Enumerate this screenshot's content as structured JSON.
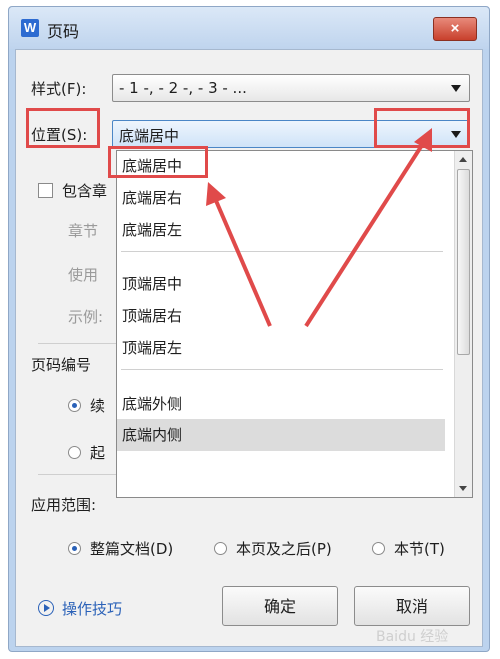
{
  "window": {
    "app_icon_letter": "W",
    "title": "页码",
    "close_label": "×"
  },
  "style_row": {
    "label": "样式(F):",
    "value": "- 1 -, - 2 -, - 3 - ..."
  },
  "position_row": {
    "label": "位置(S):",
    "value": "底端居中"
  },
  "include_chapter": {
    "label": "包含章",
    "checked": false
  },
  "chapter_start_label": "章节",
  "use_label": "使用",
  "example_label": "示例:",
  "numbering_section": "页码编号",
  "numbering_continue": "续",
  "numbering_start": "起",
  "dropdown": {
    "options": [
      "底端居中",
      "底端居右",
      "底端居左",
      "顶端居中",
      "顶端居右",
      "顶端居左",
      "底端外侧",
      "底端内侧"
    ],
    "highlighted": "底端内侧"
  },
  "apply_section": {
    "label": "应用范围:",
    "options": [
      "整篇文档(D)",
      "本页及之后(P)",
      "本节(T)"
    ],
    "selected": "整篇文档(D)"
  },
  "tips_link": "操作技巧",
  "ok_label": "确定",
  "cancel_label": "取消",
  "watermark": "Baidu 经验",
  "colors": {
    "annotation_red": "#e04a4a",
    "title_blue": "#bcd3ee",
    "link_blue": "#2a61b8"
  }
}
